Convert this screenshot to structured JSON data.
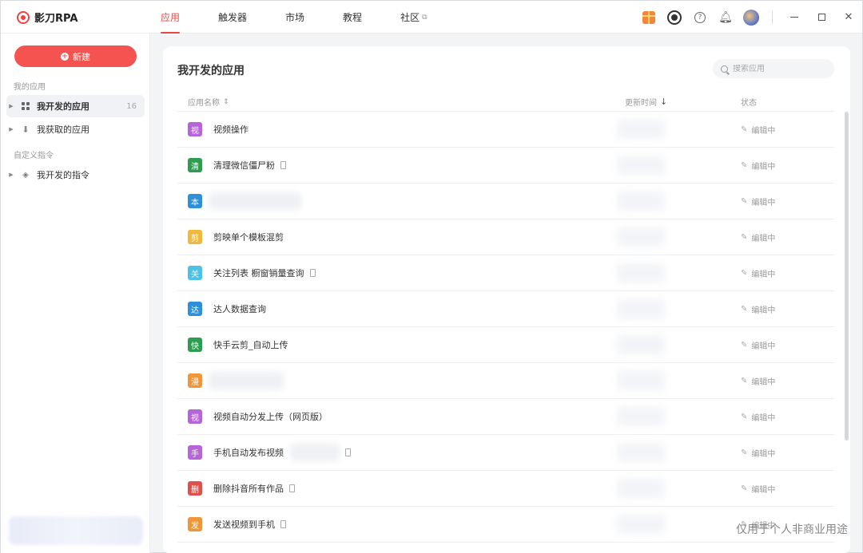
{
  "app": {
    "name": "影刀RPA"
  },
  "nav": [
    {
      "label": "应用",
      "active": true
    },
    {
      "label": "触发器",
      "active": false
    },
    {
      "label": "市场",
      "active": false
    },
    {
      "label": "教程",
      "active": false
    },
    {
      "label": "社区",
      "active": false,
      "external": true
    }
  ],
  "toolbar_icons": [
    "gift-icon",
    "eye-icon",
    "help-icon",
    "bell-icon",
    "avatar"
  ],
  "window_controls": [
    "minimize",
    "maximize",
    "close"
  ],
  "sidebar": {
    "new_button": "新建",
    "section_apps": "我的应用",
    "item_my_apps": {
      "label": "我开发的应用",
      "count": "16"
    },
    "item_got_apps": {
      "label": "我获取的应用"
    },
    "section_cmds": "自定义指令",
    "item_my_cmds": {
      "label": "我开发的指令"
    }
  },
  "main": {
    "title": "我开发的应用",
    "search_placeholder": "搜索应用",
    "columns": {
      "name": "应用名称",
      "updated": "更新时间",
      "status": "状态"
    },
    "rows": [
      {
        "badge": "视",
        "color": "#b565d8",
        "name": "视频操作",
        "status": "编辑中"
      },
      {
        "badge": "清",
        "color": "#2e9d4f",
        "name": "清理微信僵尸粉",
        "status": "编辑中"
      },
      {
        "badge": "本",
        "color": "#2f8fd8",
        "name": "",
        "status": "编辑中"
      },
      {
        "badge": "剪",
        "color": "#f0b93a",
        "name": "剪映单个模板混剪",
        "status": "编辑中"
      },
      {
        "badge": "关",
        "color": "#4ec1e8",
        "name": "关注列表 橱窗销量查询",
        "status": "编辑中"
      },
      {
        "badge": "达",
        "color": "#2f8fd8",
        "name": "达人数据查询",
        "status": "编辑中"
      },
      {
        "badge": "快",
        "color": "#2e9d4f",
        "name": "快手云剪_自动上传",
        "status": "编辑中"
      },
      {
        "badge": "漫",
        "color": "#f0963a",
        "name": "",
        "status": "编辑中"
      },
      {
        "badge": "视",
        "color": "#b565d8",
        "name": "视频自动分发上传（网页版）",
        "status": "编辑中"
      },
      {
        "badge": "手",
        "color": "#b565d8",
        "name": "手机自动发布视频",
        "status": "编辑中"
      },
      {
        "badge": "删",
        "color": "#e0504a",
        "name": "删除抖音所有作品",
        "status": "编辑中"
      },
      {
        "badge": "发",
        "color": "#f0963a",
        "name": "发送视频到手机",
        "status": "编辑中"
      }
    ]
  },
  "watermark": "仅用于个人非商业用途"
}
